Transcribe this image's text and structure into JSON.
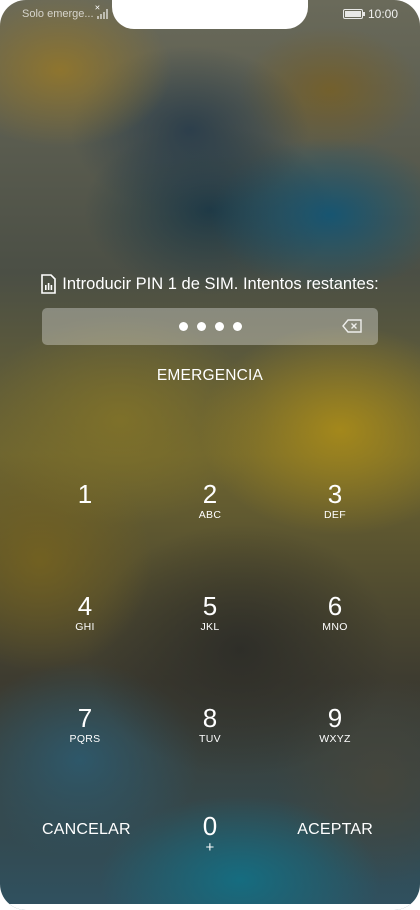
{
  "status_bar": {
    "carrier_text": "Solo emerge...",
    "time": "10:00",
    "icons": [
      "no-signal-icon",
      "battery-icon"
    ]
  },
  "prompt": {
    "icon": "sim-card-icon",
    "text": "Introducir PIN 1 de SIM. Intentos restantes:"
  },
  "pin_field": {
    "masked_digits": 4,
    "icon": "backspace-icon"
  },
  "emergency_label": "EMERGENCIA",
  "keypad": {
    "keys": [
      {
        "num": "1",
        "letters": ""
      },
      {
        "num": "2",
        "letters": "ABC"
      },
      {
        "num": "3",
        "letters": "DEF"
      },
      {
        "num": "4",
        "letters": "GHI"
      },
      {
        "num": "5",
        "letters": "JKL"
      },
      {
        "num": "6",
        "letters": "MNO"
      },
      {
        "num": "7",
        "letters": "PQRS"
      },
      {
        "num": "8",
        "letters": "TUV"
      },
      {
        "num": "9",
        "letters": "WXYZ"
      },
      {
        "num": "0",
        "letters": "+"
      }
    ],
    "cancel_label": "CANCELAR",
    "accept_label": "ACEPTAR"
  }
}
